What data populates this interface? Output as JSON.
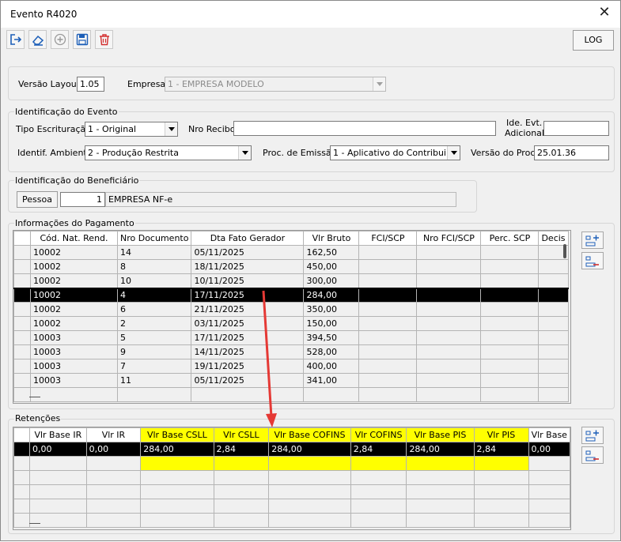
{
  "window": {
    "title": "Evento R4020"
  },
  "toolbar": {
    "log_label": "LOG"
  },
  "layout_group": {
    "versao_layout_label": "Versão Layout",
    "versao_layout_value": "1.05",
    "empresa_label": "Empresa",
    "empresa_value": "1 - EMPRESA MODELO"
  },
  "evento": {
    "group_label": "Identificação do Evento",
    "tipo_escrituracao_label": "Tipo Escrituração",
    "tipo_escrituracao_value": "1 - Original",
    "nro_recibo_label": "Nro Recibo",
    "nro_recibo_value": "",
    "ide_evt_label_1": "Ide. Evt.",
    "ide_evt_label_2": "Adicional",
    "ide_evt_value": "",
    "ambiente_label": "Identif. Ambiente",
    "ambiente_value": "2 - Produção Restrita",
    "proc_emissao_label": "Proc. de Emissão",
    "proc_emissao_value": "1 - Aplicativo do Contribuinte",
    "versao_proc_label": "Versão do Proc.",
    "versao_proc_value": "25.01.36"
  },
  "beneficiario": {
    "group_label": "Identificação do Beneficiário",
    "pessoa_label": "Pessoa",
    "pessoa_code": "1",
    "pessoa_name": "EMPRESA NF-e"
  },
  "pagamento": {
    "group_label": "Informações do Pagamento",
    "columns": [
      "Cód. Nat. Rend.",
      "Nro Documento",
      "Dta Fato Gerador",
      "Vlr Bruto",
      "FCI/SCP",
      "Nro FCI/SCP",
      "Perc. SCP",
      "Decis"
    ],
    "rows": [
      [
        "10002",
        "14",
        "05/11/2025",
        "162,50"
      ],
      [
        "10002",
        "8",
        "18/11/2025",
        "450,00"
      ],
      [
        "10002",
        "10",
        "10/11/2025",
        "300,00"
      ],
      [
        "10002",
        "4",
        "17/11/2025",
        "284,00"
      ],
      [
        "10002",
        "6",
        "21/11/2025",
        "350,00"
      ],
      [
        "10002",
        "2",
        "03/11/2025",
        "150,00"
      ],
      [
        "10003",
        "5",
        "17/11/2025",
        "394,50"
      ],
      [
        "10003",
        "9",
        "14/11/2025",
        "528,00"
      ],
      [
        "10003",
        "7",
        "19/11/2025",
        "400,00"
      ],
      [
        "10003",
        "11",
        "05/11/2025",
        "341,00"
      ]
    ],
    "selected_row": 3
  },
  "retencoes": {
    "group_label": "Retenções",
    "columns": [
      "Vlr Base IR",
      "Vlr IR",
      "Vlr Base CSLL",
      "Vlr CSLL",
      "Vlr Base COFINS",
      "Vlr COFINS",
      "Vlr Base PIS",
      "Vlr PIS",
      "Vlr Base"
    ],
    "rows": [
      [
        "0,00",
        "0,00",
        "284,00",
        "2,84",
        "284,00",
        "2,84",
        "284,00",
        "2,84",
        "0,00"
      ]
    ]
  },
  "colors": {
    "highlight": "#ffff00",
    "selection": "#000000",
    "arrow": "#e53935"
  }
}
